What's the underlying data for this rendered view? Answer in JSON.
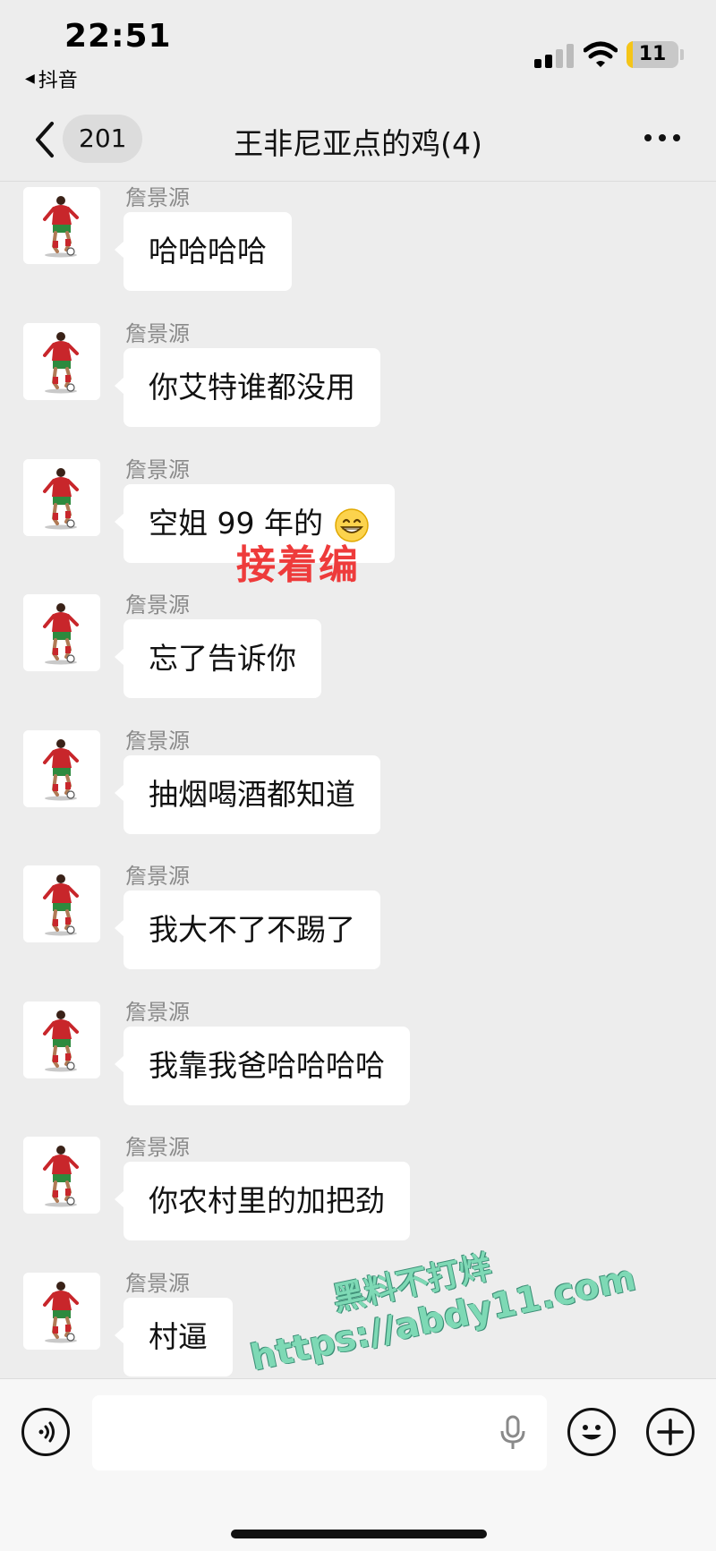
{
  "status_bar": {
    "time": "22:51",
    "back_app": "抖音",
    "battery": "11"
  },
  "nav": {
    "unread_count": "201",
    "title": "王非尼亚点的鸡(4)"
  },
  "messages": [
    {
      "sender": "詹景源",
      "text": "哈哈哈哈"
    },
    {
      "sender": "詹景源",
      "text": "你艾特谁都没用"
    },
    {
      "sender": "詹景源",
      "text": "空姐 99 年的",
      "emoji": "grinning-face-icon"
    },
    {
      "sender": "詹景源",
      "text": "忘了告诉你"
    },
    {
      "sender": "詹景源",
      "text": "抽烟喝酒都知道"
    },
    {
      "sender": "詹景源",
      "text": "我大不了不踢了"
    },
    {
      "sender": "詹景源",
      "text": "我靠我爸哈哈哈哈"
    },
    {
      "sender": "詹景源",
      "text": "你农村里的加把劲"
    },
    {
      "sender": "詹景源",
      "text": "村逼"
    }
  ],
  "overlay_text": "接着编",
  "watermark": {
    "line1": "黑料不打烊",
    "line2": "https://abdy11.com"
  },
  "input": {
    "placeholder": ""
  },
  "colors": {
    "background": "#ededed",
    "bubble": "#ffffff",
    "overlay_red": "#ee3b3b",
    "watermark_green": "#7ed9b5"
  }
}
